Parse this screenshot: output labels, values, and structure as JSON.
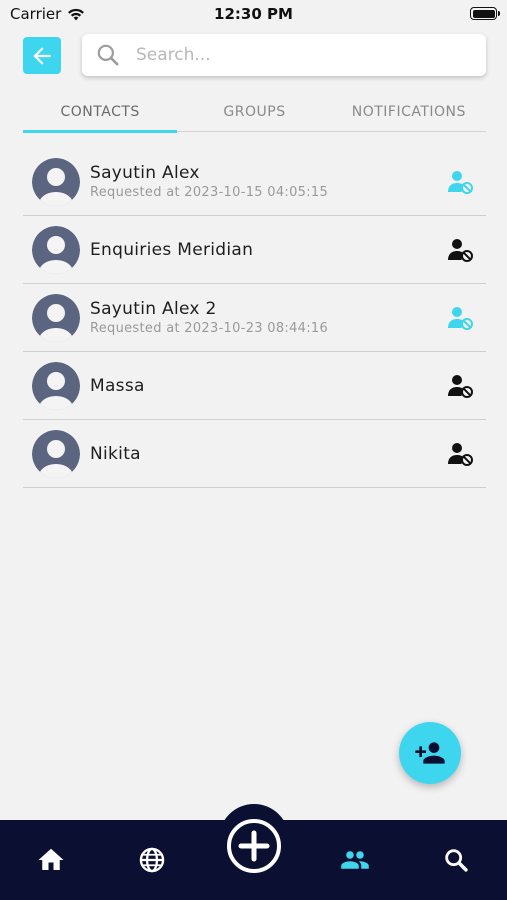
{
  "status_bar": {
    "carrier": "Carrier",
    "time": "12:30 PM"
  },
  "search": {
    "placeholder": "Search..."
  },
  "tabs": [
    {
      "label": "CONTACTS",
      "active": true
    },
    {
      "label": "GROUPS",
      "active": false
    },
    {
      "label": "NOTIFICATIONS",
      "active": false
    }
  ],
  "contacts": [
    {
      "name": "Sayutin Alex",
      "subtitle": "Requested at 2023-10-15 04:05:15",
      "action_icon": "person-blocked-icon",
      "action_color": "#3ed6ee"
    },
    {
      "name": "Enquiries Meridian",
      "subtitle": "",
      "action_icon": "person-blocked-icon",
      "action_color": "#111111"
    },
    {
      "name": "Sayutin Alex 2",
      "subtitle": "Requested at 2023-10-23 08:44:16",
      "action_icon": "person-blocked-icon",
      "action_color": "#3ed6ee"
    },
    {
      "name": "Massa",
      "subtitle": "",
      "action_icon": "person-blocked-icon",
      "action_color": "#111111"
    },
    {
      "name": "Nikita",
      "subtitle": "",
      "action_icon": "person-blocked-icon",
      "action_color": "#111111"
    }
  ],
  "colors": {
    "accent": "#3ed6ee",
    "nav_background": "#0b1033",
    "avatar": "#5b6580"
  },
  "bottom_nav": {
    "items": [
      "home-icon",
      "globe-icon",
      "add-circle-icon",
      "people-icon",
      "search-icon"
    ],
    "active": "people-icon"
  },
  "fab": {
    "icon": "add-person-icon"
  }
}
